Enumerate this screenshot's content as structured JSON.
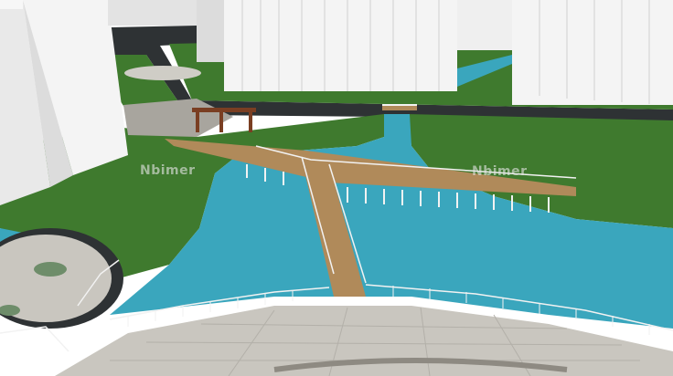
{
  "scene": {
    "description_label": "",
    "colors": {
      "lawn": "#3f7a2e",
      "lawn_light": "#4c8a36",
      "water": "#3aa6bd",
      "water_dark": "#2f8ea5",
      "road": "#2e3234",
      "plaza": "#c9c6bf",
      "plaza_tile": "#b9b6af",
      "tower": "#f4f4f4",
      "tower_shade": "#d6d6d6",
      "deck": "#b08a5a",
      "railing": "#f2f2f2",
      "pergola": "#7a3e22"
    },
    "icons": [
      "pergola-icon",
      "bridge-icon"
    ]
  },
  "watermarks": {
    "left": "Nbimer",
    "right": "Nbimer"
  }
}
